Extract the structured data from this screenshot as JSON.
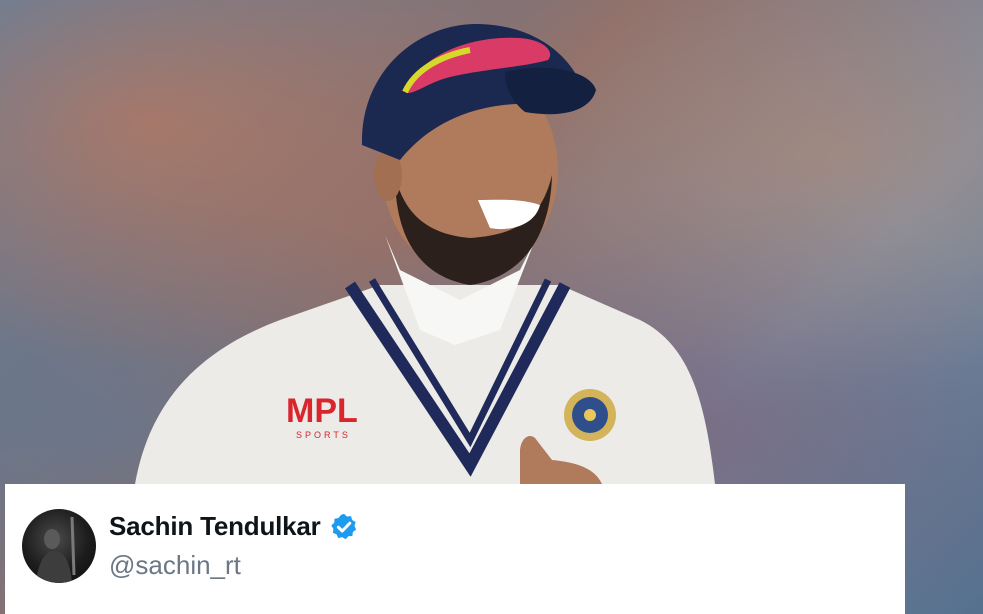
{
  "photo": {
    "subject": "cricketer-in-white-sweater",
    "logo_text": "MPL",
    "logo_subtext": "SPORTS"
  },
  "tweet": {
    "author_name": "Sachin Tendulkar",
    "author_handle": "@sachin_rt",
    "verified": true,
    "verified_color": "#1d9bf0"
  }
}
